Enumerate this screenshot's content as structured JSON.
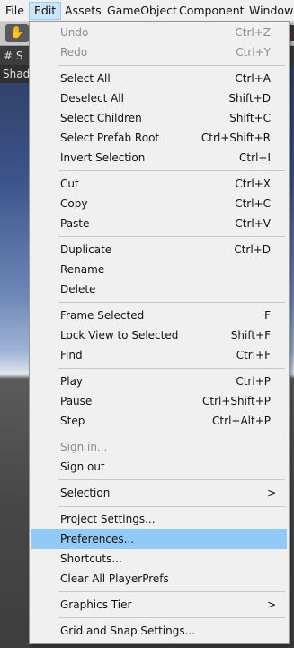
{
  "menubar": {
    "items": [
      "File",
      "Edit",
      "Assets",
      "GameObject",
      "Component",
      "Window"
    ]
  },
  "background": {
    "scene_tab_label": "# S",
    "shading_label": "Shad"
  },
  "edit_menu": {
    "highlighted_item": "Preferences...",
    "items": [
      {
        "label": "Undo",
        "shortcut": "Ctrl+Z",
        "disabled": true
      },
      {
        "label": "Redo",
        "shortcut": "Ctrl+Y",
        "disabled": true
      },
      {
        "label": "Select All",
        "shortcut": "Ctrl+A"
      },
      {
        "label": "Deselect All",
        "shortcut": "Shift+D"
      },
      {
        "label": "Select Children",
        "shortcut": "Shift+C"
      },
      {
        "label": "Select Prefab Root",
        "shortcut": "Ctrl+Shift+R"
      },
      {
        "label": "Invert Selection",
        "shortcut": "Ctrl+I"
      },
      {
        "label": "Cut",
        "shortcut": "Ctrl+X"
      },
      {
        "label": "Copy",
        "shortcut": "Ctrl+C"
      },
      {
        "label": "Paste",
        "shortcut": "Ctrl+V"
      },
      {
        "label": "Duplicate",
        "shortcut": "Ctrl+D"
      },
      {
        "label": "Rename",
        "shortcut": ""
      },
      {
        "label": "Delete",
        "shortcut": ""
      },
      {
        "label": "Frame Selected",
        "shortcut": "F"
      },
      {
        "label": "Lock View to Selected",
        "shortcut": "Shift+F"
      },
      {
        "label": "Find",
        "shortcut": "Ctrl+F"
      },
      {
        "label": "Play",
        "shortcut": "Ctrl+P"
      },
      {
        "label": "Pause",
        "shortcut": "Ctrl+Shift+P"
      },
      {
        "label": "Step",
        "shortcut": "Ctrl+Alt+P"
      },
      {
        "label": "Sign in...",
        "shortcut": "",
        "disabled": true
      },
      {
        "label": "Sign out",
        "shortcut": ""
      },
      {
        "label": "Selection",
        "shortcut": "",
        "submenu_arrow": ">"
      },
      {
        "label": "Project Settings...",
        "shortcut": ""
      },
      {
        "label": "Preferences...",
        "shortcut": ""
      },
      {
        "label": "Shortcuts...",
        "shortcut": ""
      },
      {
        "label": "Clear All PlayerPrefs",
        "shortcut": ""
      },
      {
        "label": "Graphics Tier",
        "shortcut": "",
        "submenu_arrow": ">"
      },
      {
        "label": "Grid and Snap Settings...",
        "shortcut": ""
      }
    ]
  },
  "colors": {
    "menu_background": "#f0f0f0",
    "highlight": "#91c9f7",
    "active_menubar_item": "#cce4f7",
    "disabled_text": "#8c8c8c"
  }
}
